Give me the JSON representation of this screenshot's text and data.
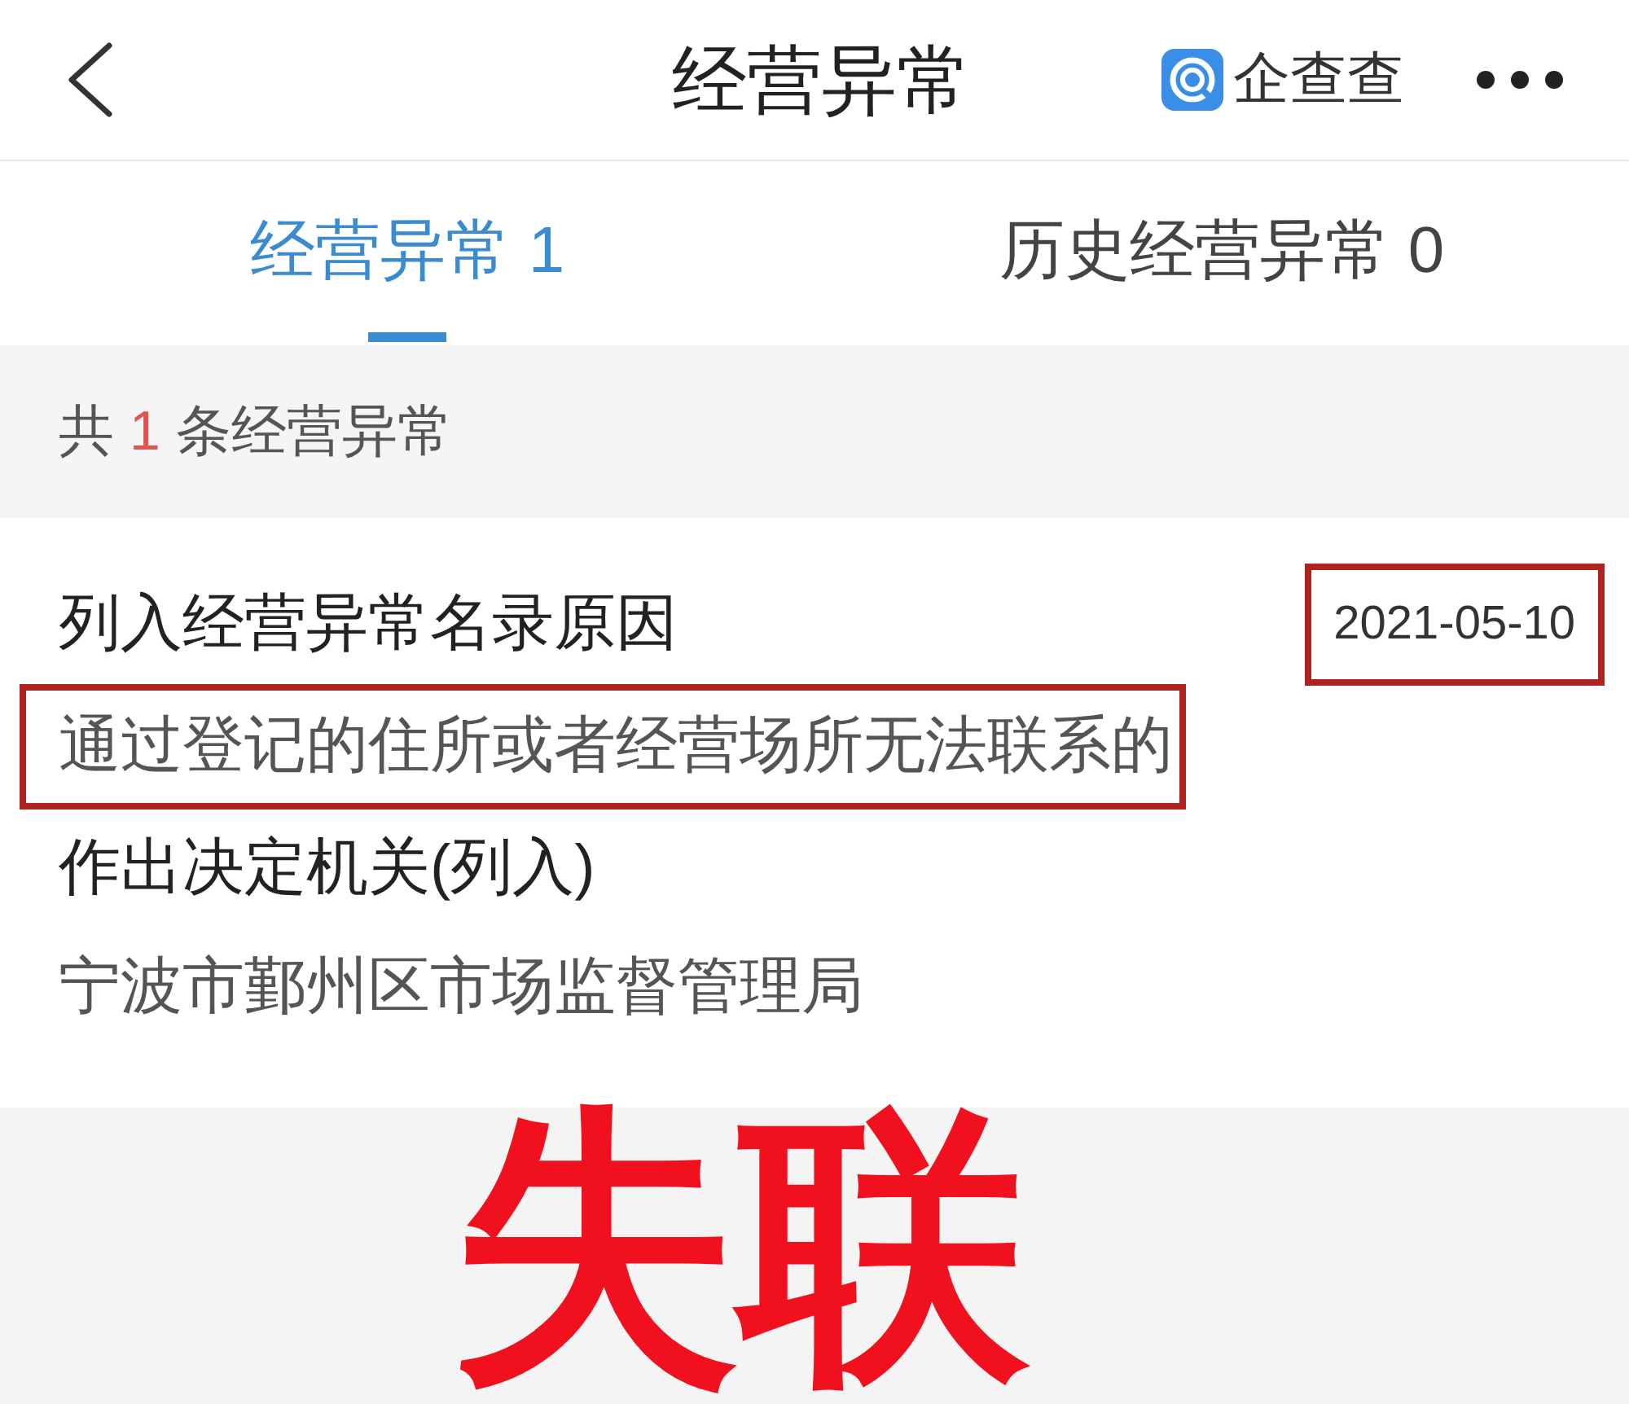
{
  "nav_bar": {
    "title": "经营异常",
    "brand": "企查查"
  },
  "tabs": [
    {
      "label": "经营异常 1",
      "selected": true
    },
    {
      "label": "历史经营异常 0",
      "selected": false
    }
  ],
  "summary": {
    "prefix": "共",
    "count": "1",
    "suffix": "条经营异常"
  },
  "record": {
    "date": "2021-05-10",
    "date_highlighted": true,
    "fields": [
      {
        "label": "列入经营异常名录原因",
        "value": "通过登记的住所或者经营场所无法联系的",
        "value_highlighted": true
      },
      {
        "label": "作出决定机关(列入)",
        "value": "宁波市鄞州区市场监督管理局",
        "value_highlighted": false
      }
    ]
  },
  "caption": "失联"
}
